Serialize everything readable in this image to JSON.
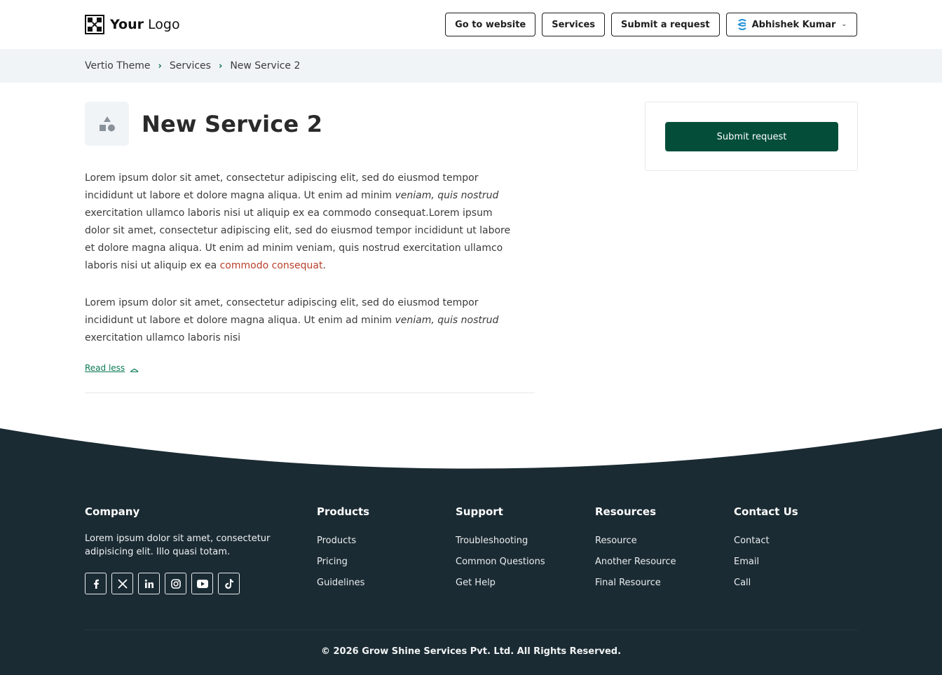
{
  "header": {
    "logo_bold": "Your",
    "logo_light": "Logo",
    "nav": {
      "go_to_website": "Go to website",
      "services": "Services",
      "submit_request": "Submit a request",
      "user_name": "Abhishek Kumar"
    }
  },
  "breadcrumb": {
    "items": [
      "Vertio Theme",
      "Services",
      "New Service 2"
    ]
  },
  "page": {
    "title": "New Service 2",
    "para1_a": "Lorem ipsum dolor sit amet, consectetur adipiscing elit, sed do eiusmod tempor incididunt ut labore et dolore magna aliqua. Ut enim ad minim ",
    "para1_italic": "veniam, quis nostrud",
    "para1_b": " exercitation ullamco laboris nisi ut aliquip ex ea commodo consequat.Lorem ipsum dolor sit amet, consectetur adipiscing elit, sed do eiusmod tempor incididunt ut labore et dolore magna aliqua. Ut enim ad minim veniam, quis nostrud exercitation ullamco laboris nisi ut aliquip ex ea ",
    "para1_link": "commodo consequat",
    "para1_end": ".",
    "para2_a": "Lorem ipsum dolor sit amet, consectetur adipiscing elit, sed do eiusmod tempor incididunt ut labore et dolore magna aliqua. Ut enim ad minim ",
    "para2_italic": "veniam, quis nostrud",
    "para2_b": " exercitation ullamco laboris nisi",
    "read_less": "Read less",
    "submit_button": "Submit request"
  },
  "footer": {
    "company": {
      "heading": "Company",
      "description": "Lorem ipsum dolor sit amet, consectetur adipisicing elit. Illo quasi totam.",
      "socials": [
        "facebook-icon",
        "x-icon",
        "linkedin-icon",
        "instagram-icon",
        "youtube-icon",
        "tiktok-icon"
      ]
    },
    "products": {
      "heading": "Products",
      "links": [
        "Products",
        "Pricing",
        "Guidelines"
      ]
    },
    "support": {
      "heading": "Support",
      "links": [
        "Troubleshooting",
        "Common Questions",
        "Get Help"
      ]
    },
    "resources": {
      "heading": "Resources",
      "links": [
        "Resource",
        "Another Resource",
        "Final Resource"
      ]
    },
    "contact": {
      "heading": "Contact Us",
      "links": [
        "Contact",
        "Email",
        "Call"
      ]
    },
    "copyright": "© 2026 Grow Shine Services Pvt. Ltd. All Rights Reserved."
  },
  "colors": {
    "primary_button": "#044e39",
    "footer_bg": "#1b2b33",
    "breadcrumb_bg": "#f1f4f7",
    "link_green": "#0a7a55",
    "link_red": "#b8402b"
  }
}
